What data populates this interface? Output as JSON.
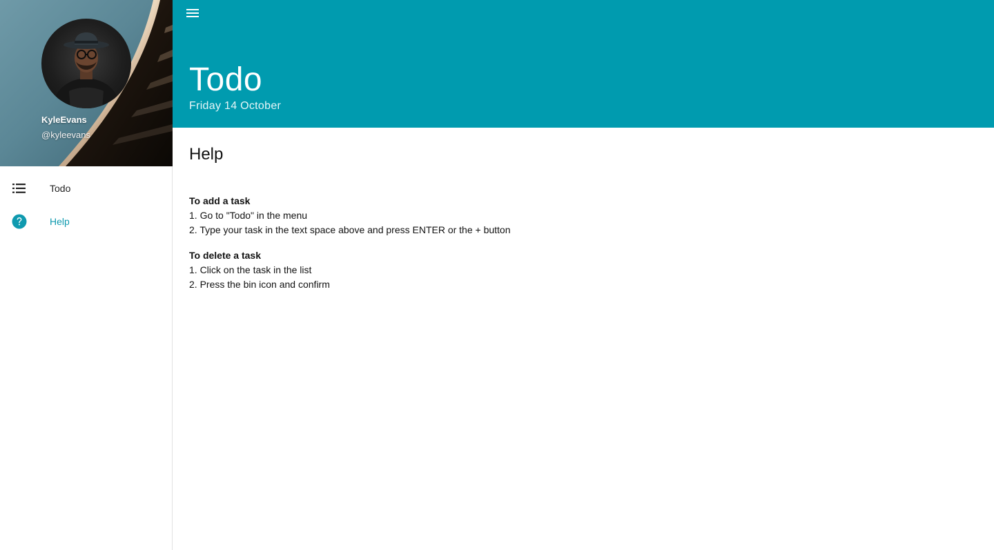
{
  "user": {
    "name": "KyleEvans",
    "handle": "@kyleevans"
  },
  "nav": {
    "items": [
      {
        "label": "Todo",
        "icon": "list-icon",
        "active": false
      },
      {
        "label": "Help",
        "icon": "help-circle-icon",
        "active": true
      }
    ]
  },
  "header": {
    "title": "Todo",
    "date": "Friday 14 October",
    "menu_icon": "hamburger-menu-icon"
  },
  "help": {
    "title": "Help",
    "sections": [
      {
        "heading": "To add a task",
        "lines": [
          "1. Go to \"Todo\" in the menu",
          "2. Type your task in the text space above and press ENTER or the + button"
        ]
      },
      {
        "heading": "To delete a task",
        "lines": [
          "1. Click on the task in the list",
          "2. Press the bin icon and confirm"
        ]
      }
    ]
  },
  "colors": {
    "accent": "#009baf",
    "active_nav": "#0f9aaf",
    "header_text": "#ffffff"
  }
}
